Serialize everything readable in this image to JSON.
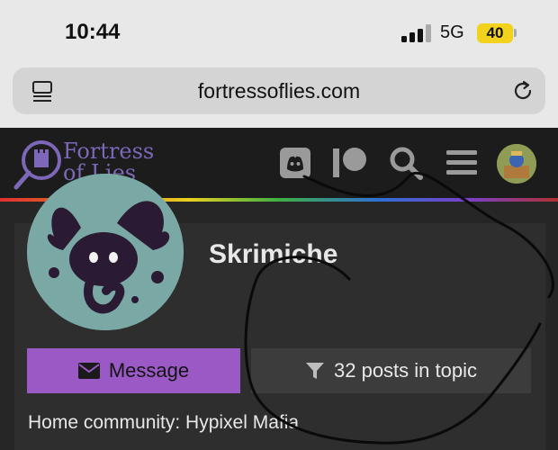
{
  "status_bar": {
    "time": "10:44",
    "network": "5G",
    "battery": "40",
    "battery_color": "#f2d21c"
  },
  "browser": {
    "url": "fortressoflies.com",
    "reader_icon": "reader-view-icon",
    "reload_icon": "reload-icon"
  },
  "header": {
    "logo_line1": "Fortress",
    "logo_line2": "of Lies",
    "icons": [
      "discord-icon",
      "patreon-icon",
      "search-icon",
      "hamburger-menu-icon",
      "user-avatar"
    ],
    "brand_color": "#7d67b8"
  },
  "profile": {
    "username": "Skrimiche",
    "message_label": "Message",
    "filter_label": "32 posts in topic",
    "home_community": "Home community: Hypixel Mafia",
    "message_button_color": "#9b59c6"
  }
}
